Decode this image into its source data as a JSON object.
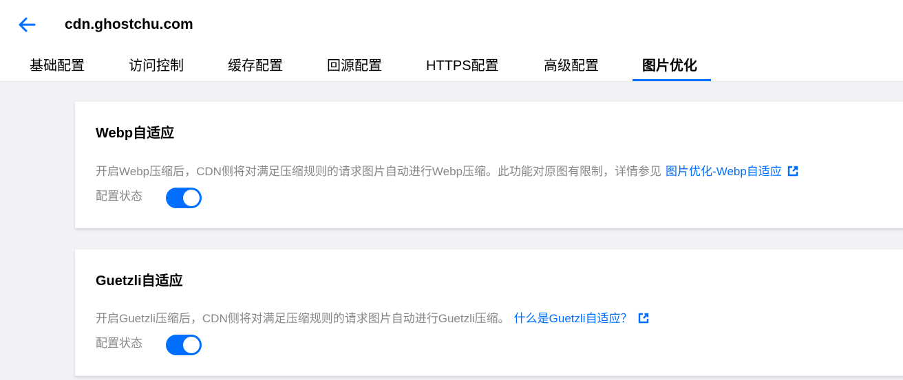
{
  "header": {
    "domain": "cdn.ghostchu.com",
    "tabs": [
      {
        "label": "基础配置"
      },
      {
        "label": "访问控制"
      },
      {
        "label": "缓存配置"
      },
      {
        "label": "回源配置"
      },
      {
        "label": "HTTPS配置"
      },
      {
        "label": "高级配置"
      },
      {
        "label": "图片优化",
        "active": true
      }
    ]
  },
  "colors": {
    "accent": "#006eff",
    "muted_text": "#888888",
    "background": "#f0f2f5"
  },
  "cards": [
    {
      "title": "Webp自适应",
      "description": "开启Webp压缩后，CDN侧将对满足压缩规则的请求图片自动进行Webp压缩。此功能对原图有限制，详情参见",
      "link": "图片优化-Webp自适应",
      "status_label": "配置状态",
      "enabled": true
    },
    {
      "title": "Guetzli自适应",
      "description": "开启Guetzli压缩后，CDN侧将对满足压缩规则的请求图片自动进行Guetzli压缩。",
      "link": "什么是Guetzli自适应？",
      "status_label": "配置状态",
      "enabled": true
    }
  ]
}
